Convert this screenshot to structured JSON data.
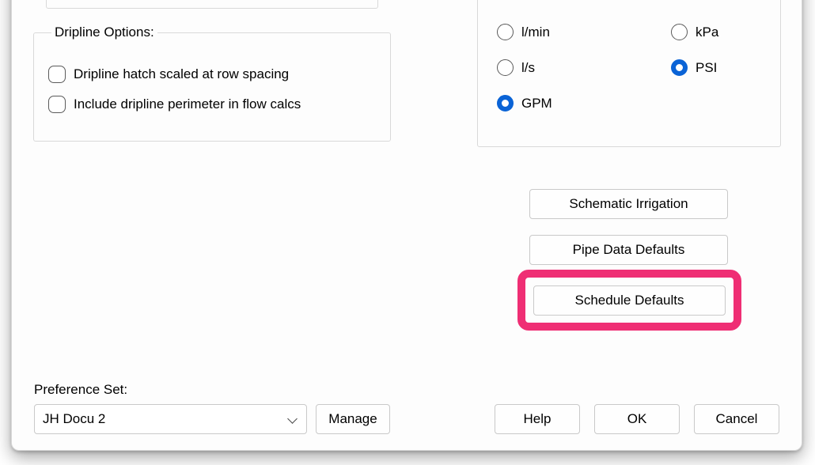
{
  "dripline": {
    "legend": "Dripline Options:",
    "hatch_label": "Dripline hatch scaled at row spacing",
    "hatch_checked": false,
    "perimeter_label": "Include dripline perimeter in flow calcs",
    "perimeter_checked": false
  },
  "units": {
    "flow": {
      "lmin": {
        "label": "l/min",
        "checked": false
      },
      "ls": {
        "label": "l/s",
        "checked": false
      },
      "gpm": {
        "label": "GPM",
        "checked": true
      }
    },
    "pressure": {
      "kpa": {
        "label": "kPa",
        "checked": false
      },
      "psi": {
        "label": "PSI",
        "checked": true
      }
    }
  },
  "buttons": {
    "schematic": "Schematic Irrigation",
    "pipe_data": "Pipe Data Defaults",
    "schedule": "Schedule Defaults",
    "manage": "Manage",
    "help": "Help",
    "ok": "OK",
    "cancel": "Cancel"
  },
  "preference_set": {
    "label": "Preference Set:",
    "selected": "JH Docu 2"
  },
  "colors": {
    "accent": "#0a63d6",
    "highlight": "#ef2e74"
  }
}
